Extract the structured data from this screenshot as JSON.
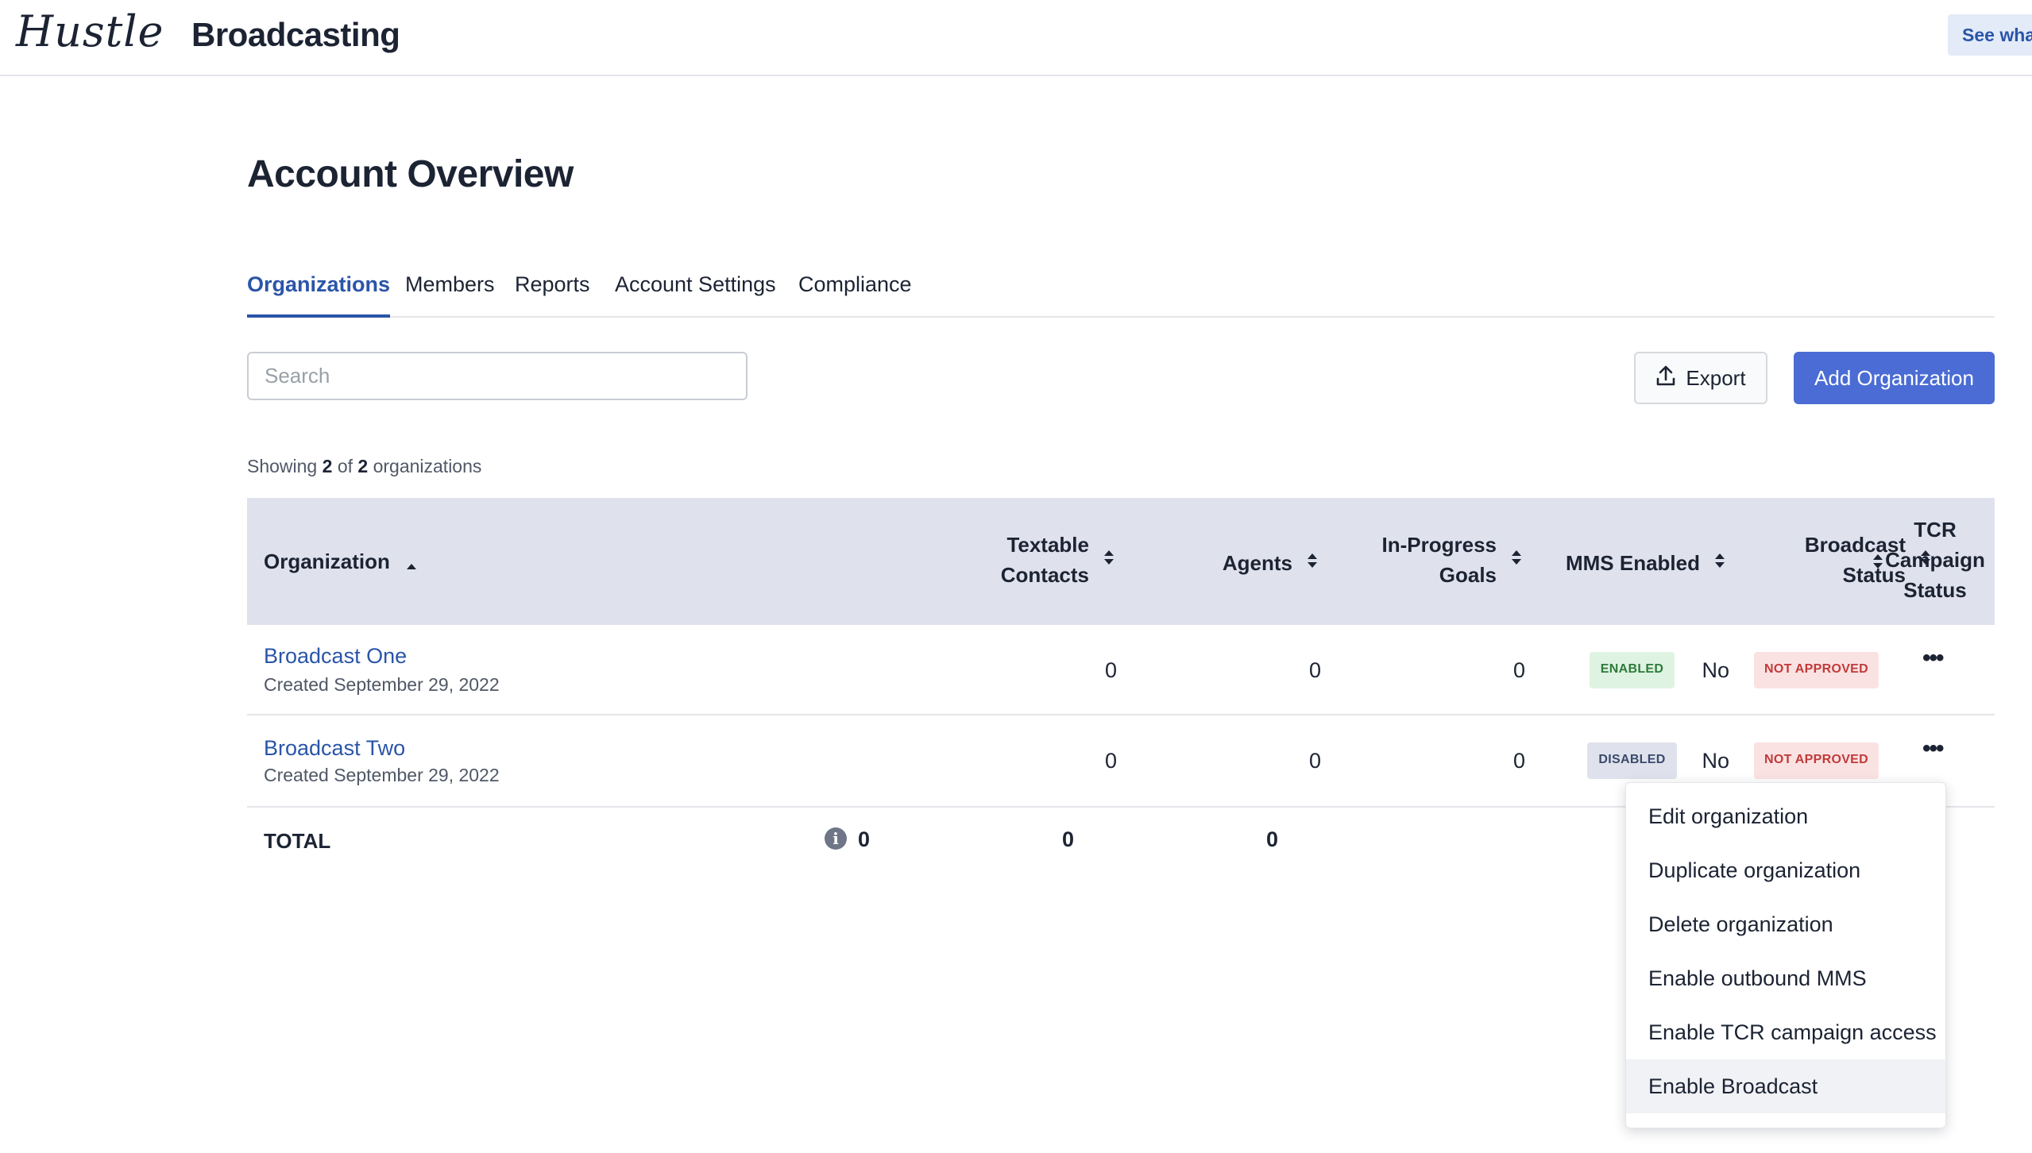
{
  "header": {
    "logo": "Hustle",
    "app_title": "Broadcasting",
    "see_what_label": "See wha"
  },
  "page": {
    "title": "Account Overview"
  },
  "tabs": [
    {
      "label": "Organizations",
      "active": true
    },
    {
      "label": "Members",
      "active": false
    },
    {
      "label": "Reports",
      "active": false
    },
    {
      "label": "Account Settings",
      "active": false
    },
    {
      "label": "Compliance",
      "active": false
    }
  ],
  "search": {
    "placeholder": "Search",
    "value": ""
  },
  "actions": {
    "export_label": "Export",
    "add_label": "Add Organization"
  },
  "summary": {
    "prefix": "Showing",
    "shown": "2",
    "of": "of",
    "total": "2",
    "suffix": "organizations"
  },
  "table": {
    "columns": {
      "organization": "Organization",
      "textable_1": "Textable",
      "textable_2": "Contacts",
      "agents": "Agents",
      "goals_1": "In-Progress",
      "goals_2": "Goals",
      "mms": "MMS Enabled",
      "broadcast_1": "Broadcast",
      "broadcast_2": "Status",
      "tcr_1": "TCR",
      "tcr_2": "Campaign",
      "tcr_3": "Status"
    },
    "rows": [
      {
        "name": "Broadcast One",
        "created": "Created September 29, 2022",
        "textable": "0",
        "agents": "0",
        "goals": "0",
        "mms": "No",
        "broadcast_status": "ENABLED",
        "tcr_status": "NOT APPROVED",
        "more": "•••"
      },
      {
        "name": "Broadcast Two",
        "created": "Created September 29, 2022",
        "textable": "0",
        "agents": "0",
        "goals": "0",
        "mms": "No",
        "broadcast_status": "DISABLED",
        "tcr_status": "NOT APPROVED",
        "more": "•••"
      }
    ],
    "total": {
      "label": "TOTAL",
      "textable": "0",
      "agents": "0",
      "goals": "0",
      "info_icon": "i"
    }
  },
  "menu": {
    "items": [
      {
        "label": "Edit organization"
      },
      {
        "label": "Duplicate organization"
      },
      {
        "label": "Delete organization"
      },
      {
        "label": "Enable outbound MMS"
      },
      {
        "label": "Enable TCR campaign access"
      },
      {
        "label": "Enable Broadcast"
      }
    ]
  },
  "colors": {
    "primary": "#4a6cd4",
    "link": "#2a55a8",
    "table_header_bg": "#dfe2ec",
    "enabled_bg": "#dff3e2",
    "not_approved_bg": "#fbe2e2"
  }
}
